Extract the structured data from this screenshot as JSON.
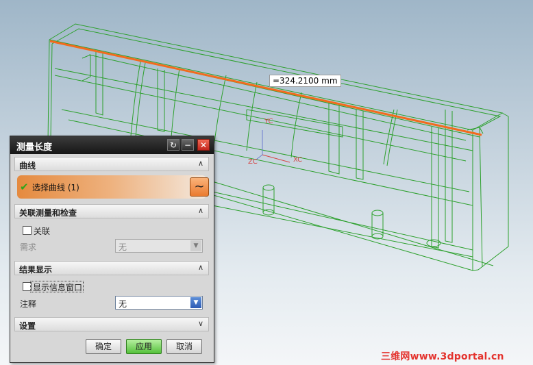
{
  "viewport": {
    "measurement": "=324.2100 mm",
    "axis_labels": {
      "yc": "YC",
      "xc": "XC",
      "zc": "ZC"
    },
    "measure_line_color": "#f26b1d",
    "wireframe_color": "#2ca02c"
  },
  "dialog": {
    "title": "测量长度",
    "title_buttons": {
      "reset_icon": "reset-icon",
      "minimize_icon": "minimize-icon",
      "close_icon": "close-icon"
    },
    "sections": {
      "curve": {
        "header": "曲线",
        "select_label": "选择曲线 (1)"
      },
      "associative": {
        "header": "关联测量和检查",
        "associative_checkbox": "关联",
        "requirement_label": "需求",
        "requirement_value": "无"
      },
      "result_display": {
        "header": "结果显示",
        "show_info_checkbox": "显示信息窗口",
        "annotation_label": "注释",
        "annotation_value": "无"
      },
      "settings": {
        "header": "设置"
      }
    },
    "buttons": {
      "ok": "确定",
      "apply": "应用",
      "cancel": "取消"
    }
  },
  "watermark": "三维网www.3dportal.cn"
}
